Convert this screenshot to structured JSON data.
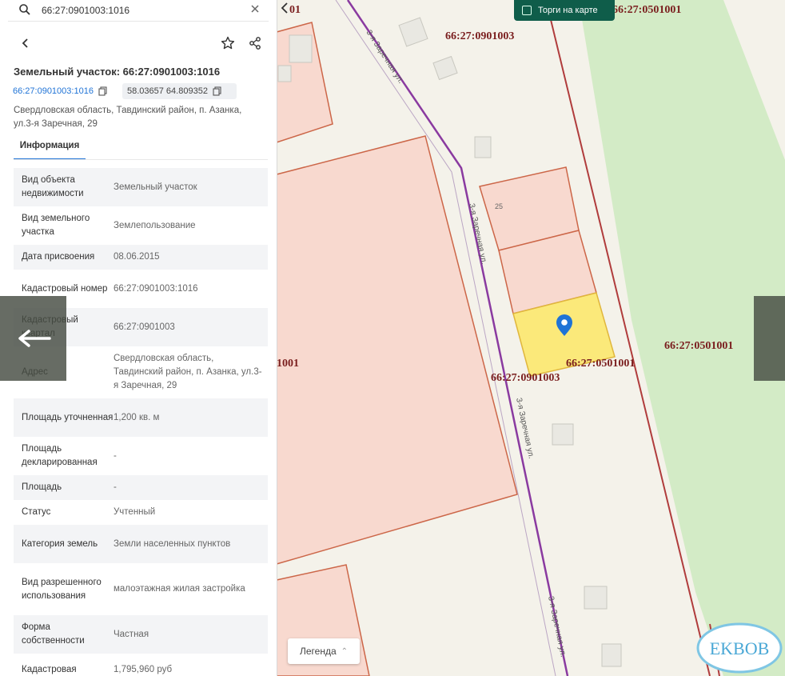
{
  "search": {
    "value": "66:27:0901003:1016"
  },
  "parcel": {
    "title": "Земельный участок: 66:27:0901003:1016",
    "cadastral_link": "66:27:0901003:1016",
    "coordinates": "58.03657 64.809352",
    "address": "Свердловская область, Тавдинский район, п. Азанка, ул.3-я Заречная, 29"
  },
  "tabs": [
    {
      "label": "Информация",
      "active": true
    }
  ],
  "info_rows": [
    {
      "label": "Вид объекта недвижимости",
      "value": "Земельный участок"
    },
    {
      "label": "Вид земельного участка",
      "value": "Землепользование"
    },
    {
      "label": "Дата присвоения",
      "value": "08.06.2015"
    },
    {
      "label": "Кадастровый номер",
      "value": "66:27:0901003:1016"
    },
    {
      "label": "Кадастровый квартал",
      "value": "66:27:0901003"
    },
    {
      "label": "Адрес",
      "value": "Свердловская область, Тавдинский район, п. Азанка, ул.3-я Заречная, 29"
    },
    {
      "label": "Площадь уточненная",
      "value": "1,200 кв. м"
    },
    {
      "label": "Площадь декларированная",
      "value": "-"
    },
    {
      "label": "Площадь",
      "value": "-"
    },
    {
      "label": "Статус",
      "value": "Учтенный"
    },
    {
      "label": "Категория земель",
      "value": "Земли населенных пунктов"
    },
    {
      "label": "Вид разрешенного использования",
      "value": "малоэтажная жилая застройка"
    },
    {
      "label": "Форма собственности",
      "value": "Частная"
    },
    {
      "label": "Кадастровая",
      "value": "1,795,960 руб"
    }
  ],
  "map": {
    "quarter_labels": [
      "66:27:0901003",
      "66:27:0901003",
      "66:27:0501001",
      "66:27:0501001",
      "66:27:0501001",
      "1001",
      "01"
    ],
    "street_label": "3-я Заречная ул.",
    "parcel_number_label": "25",
    "torgi_label": "Торги на карте",
    "legend_label": "Легенда",
    "watermark": "EKBOB",
    "colors": {
      "selected_parcel": "#fbe97a",
      "parcel_fill": "#f8d9cf",
      "parcel_stroke": "#cc6648",
      "quarter_boundary": "#b03c3c",
      "street_line": "#8a3aa0",
      "greenery": "#d3ebc6",
      "accent": "#1f73d6"
    }
  }
}
